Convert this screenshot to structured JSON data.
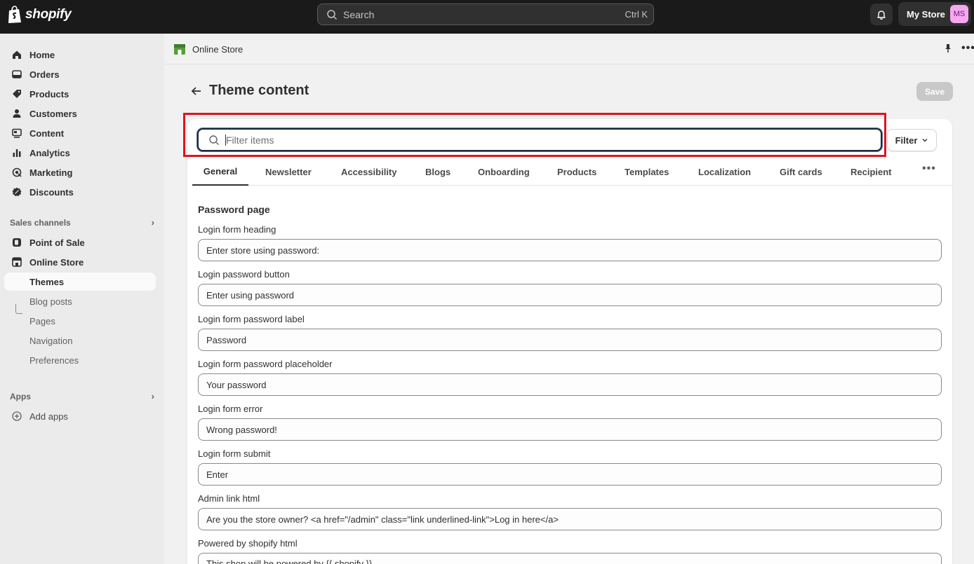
{
  "topbar": {
    "logo_text": "shopify",
    "search_placeholder": "Search",
    "search_shortcut": "Ctrl K",
    "store_name": "My Store",
    "avatar_initials": "MS"
  },
  "sidebar": {
    "main_items": [
      {
        "label": "Home",
        "icon": "home-icon"
      },
      {
        "label": "Orders",
        "icon": "orders-icon"
      },
      {
        "label": "Products",
        "icon": "tag-icon"
      },
      {
        "label": "Customers",
        "icon": "person-icon"
      },
      {
        "label": "Content",
        "icon": "content-icon"
      },
      {
        "label": "Analytics",
        "icon": "bar-chart-icon"
      },
      {
        "label": "Marketing",
        "icon": "target-icon"
      },
      {
        "label": "Discounts",
        "icon": "discount-icon"
      }
    ],
    "sales_channels_label": "Sales channels",
    "channels": [
      {
        "label": "Point of Sale",
        "icon": "pos-icon"
      },
      {
        "label": "Online Store",
        "icon": "store-icon"
      }
    ],
    "sub_items": [
      "Themes",
      "Blog posts",
      "Pages",
      "Navigation",
      "Preferences"
    ],
    "apps_label": "Apps",
    "add_apps_label": "Add apps"
  },
  "header": {
    "breadcrumb": "Online Store"
  },
  "page": {
    "title": "Theme content",
    "save_label": "Save",
    "filter_placeholder": "Filter items",
    "filter_button": "Filter",
    "tabs": [
      "General",
      "Newsletter",
      "Accessibility",
      "Blogs",
      "Onboarding",
      "Products",
      "Templates",
      "Localization",
      "Gift cards",
      "Recipient"
    ],
    "active_tab": "General",
    "section_title": "Password page",
    "fields": [
      {
        "label": "Login form heading",
        "value": "Enter store using password:"
      },
      {
        "label": "Login password button",
        "value": "Enter using password"
      },
      {
        "label": "Login form password label",
        "value": "Password"
      },
      {
        "label": "Login form password placeholder",
        "value": "Your password"
      },
      {
        "label": "Login form error",
        "value": "Wrong password!"
      },
      {
        "label": "Login form submit",
        "value": "Enter"
      },
      {
        "label": "Admin link html",
        "value": "Are you the store owner? <a href=\"/admin\" class=\"link underlined-link\">Log in here</a>"
      },
      {
        "label": "Powered by shopify html",
        "value": "This shop will be powered by {{ shopify }}"
      }
    ]
  },
  "colors": {
    "topbar_bg": "#1a1a1a",
    "highlight": "#e0141e",
    "avatar_bg": "#f5a8f0"
  }
}
